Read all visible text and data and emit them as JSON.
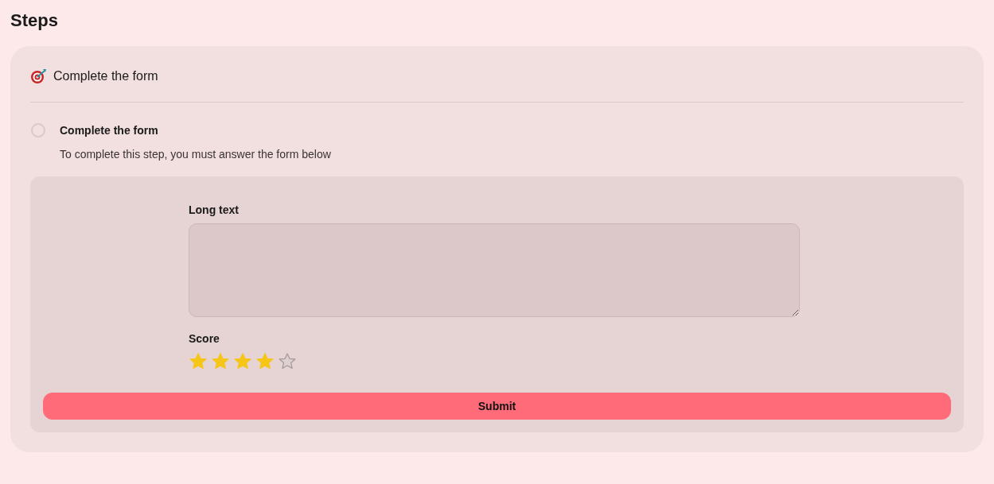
{
  "page_title": "Steps",
  "card": {
    "title": "Complete the form",
    "step": {
      "title": "Complete the form",
      "description": "To complete this step, you must answer the form below",
      "checked": false
    },
    "form": {
      "fields": [
        {
          "kind": "textarea",
          "label": "Long text"
        },
        {
          "kind": "rating",
          "label": "Score",
          "stars": 4
        }
      ],
      "submit": "Submit"
    }
  }
}
